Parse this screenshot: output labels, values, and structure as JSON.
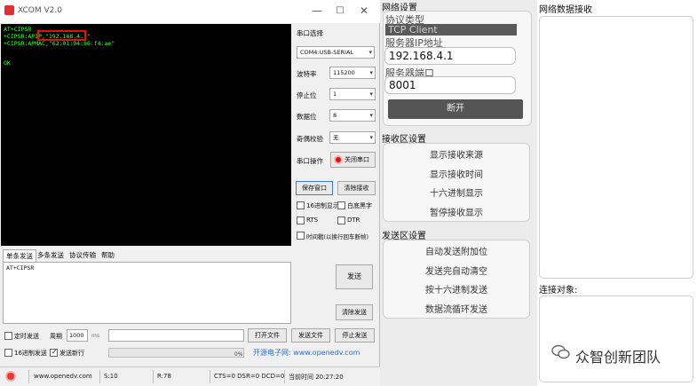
{
  "xcom": {
    "title": "XCOM V2.0",
    "window_controls": {
      "minimize": "—",
      "maximize": "□",
      "close": "✕"
    },
    "terminal_lines": [
      "AT+CIPSR",
      "+CIPSR:APIP,\"192.168.4.1\"",
      "+CIPSR:APMAC,\"62:01:94:86:f4:ae\"",
      "",
      "OK"
    ],
    "highlighted_ip": "192.168.4.1",
    "settings": {
      "port_label": "串口选择",
      "port_value": "COM4:USB-SERIAL",
      "baud_label": "波特率",
      "baud_value": "115200",
      "stop_label": "停止位",
      "stop_value": "1",
      "data_label": "数据位",
      "data_value": "8",
      "parity_label": "奇偶校验",
      "parity_value": "无",
      "op_label": "串口操作",
      "op_button": "关闭串口",
      "save_button": "保存窗口",
      "clear_recv_button": "清除接收",
      "hex_display": "16进制显示",
      "white_black": "白底黑字",
      "rts": "RTS",
      "dtr": "DTR",
      "timestamp": "时间戳(以换行回车断帧)"
    },
    "tabs": [
      "单条发送",
      "多条发送",
      "协议传输",
      "帮助"
    ],
    "send_text": "AT+CIPSR",
    "send_button": "发送",
    "clear_send_button": "清除发送",
    "timed_send": "定时发送",
    "period_label": "周期",
    "period_value": "1000",
    "period_unit": "ms",
    "open_file": "打开文件",
    "send_file": "发送文件",
    "stop_send": "停止发送",
    "hex_send": "16进制发送",
    "send_newline": "发送新行",
    "progress": "0%",
    "brand_text": "开源电子网: www.openedv.com",
    "status": {
      "url": "www.openedv.com",
      "sent": "S:10",
      "recv": "R:78",
      "lines": "CTS=0 DSR=0 DCD=0",
      "time": "当前时间 20:27:20"
    }
  },
  "net": {
    "network_settings_title": "网络设置",
    "protocol_label": "协议类型",
    "protocol_value": "TCP Client",
    "server_ip_label": "服务器IP地址",
    "server_ip": "192.168.4.1",
    "server_port_label": "服务器端口",
    "server_port": "8001",
    "disconnect_button": "断开",
    "recv_settings_title": "接收区设置",
    "recv_options": [
      "显示接收来源",
      "显示接收时间",
      "十六进制显示",
      "暂停接收显示"
    ],
    "send_settings_title": "发送区设置",
    "send_options": [
      "自动发送附加位",
      "发送完自动清空",
      "按十六进制发送",
      "数据流循环发送"
    ]
  },
  "recv_panel": {
    "title": "网络数据接收",
    "conn_title": "连接对象:",
    "watermark": "众智创新团队"
  },
  "colors": {
    "terminal_bg": "#000000",
    "terminal_text": "#35ff35",
    "highlight": "#e01010"
  }
}
